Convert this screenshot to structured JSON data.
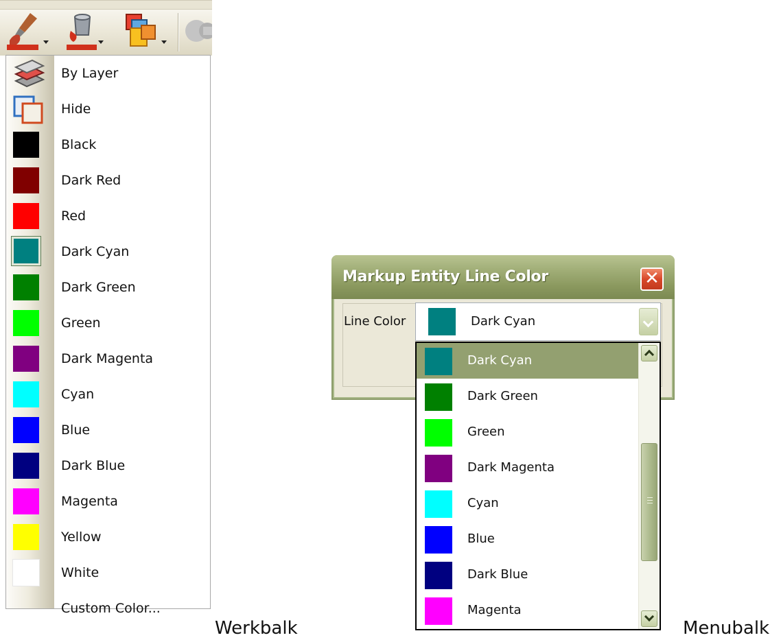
{
  "toolbar": {
    "buttons": [
      {
        "icon": "line-color-brush-icon"
      },
      {
        "icon": "fill-color-bucket-icon"
      },
      {
        "icon": "color-layers-icon"
      },
      {
        "icon": "tool-icon"
      }
    ]
  },
  "toolbar_menu": {
    "items": [
      {
        "label": "By Layer",
        "icon": "by-layer-icon"
      },
      {
        "label": "Hide",
        "icon": "hide-icon"
      },
      {
        "label": "Black",
        "color": "#000000"
      },
      {
        "label": "Dark Red",
        "color": "#800000"
      },
      {
        "label": "Red",
        "color": "#ff0000"
      },
      {
        "label": "Dark Cyan",
        "color": "#008080",
        "checked": true
      },
      {
        "label": "Dark Green",
        "color": "#008000"
      },
      {
        "label": "Green",
        "color": "#00ff00"
      },
      {
        "label": "Dark Magenta",
        "color": "#800080"
      },
      {
        "label": "Cyan",
        "color": "#00ffff"
      },
      {
        "label": "Blue",
        "color": "#0000ff"
      },
      {
        "label": "Dark Blue",
        "color": "#000080"
      },
      {
        "label": "Magenta",
        "color": "#ff00ff"
      },
      {
        "label": "Yellow",
        "color": "#ffff00"
      },
      {
        "label": "White",
        "color": "#ffffff"
      },
      {
        "label": "Custom Color..."
      }
    ]
  },
  "dialog": {
    "title": "Markup Entity Line Color",
    "close_glyph": "✕",
    "field_label": "Line Color",
    "selected_value": "Dark Cyan",
    "selected_color": "#008080",
    "options": [
      {
        "label": "Dark Cyan",
        "color": "#008080",
        "selected": true
      },
      {
        "label": "Dark Green",
        "color": "#008000"
      },
      {
        "label": "Green",
        "color": "#00ff00"
      },
      {
        "label": "Dark Magenta",
        "color": "#800080"
      },
      {
        "label": "Cyan",
        "color": "#00ffff"
      },
      {
        "label": "Blue",
        "color": "#0000ff"
      },
      {
        "label": "Dark Blue",
        "color": "#000080"
      },
      {
        "label": "Magenta",
        "color": "#ff00ff"
      }
    ]
  },
  "captions": {
    "left": "Werkbalk",
    "right": "Menubalk"
  }
}
